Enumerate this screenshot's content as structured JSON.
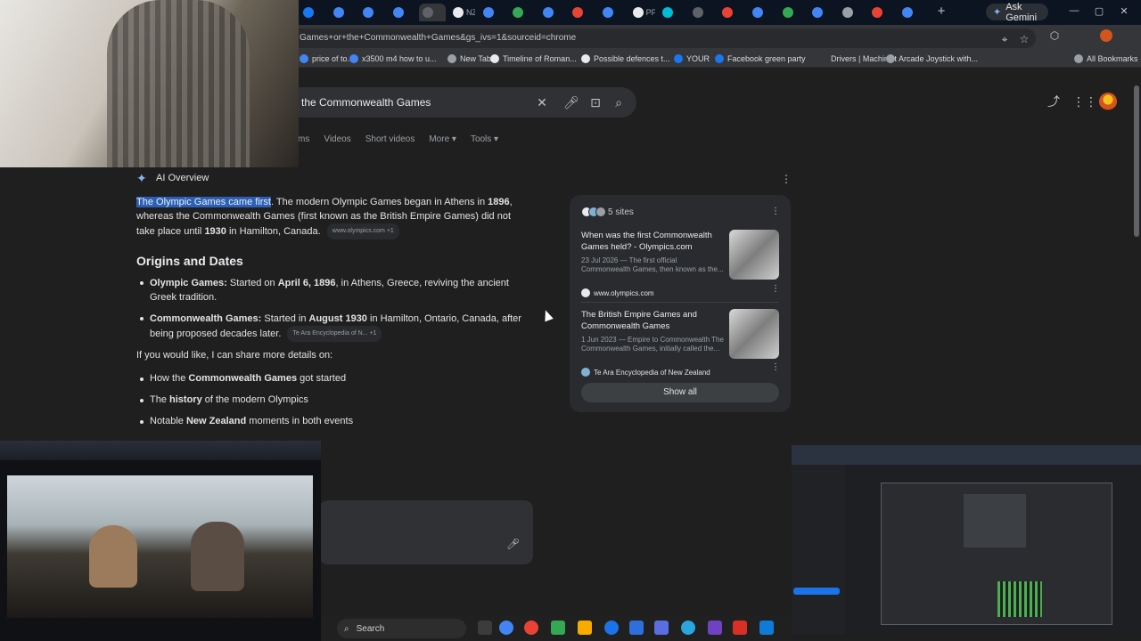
{
  "browser": {
    "ask_gemini": "Ask Gemini",
    "url": "Games+or+the+Commonwealth+Games&gs_ivs=1&sourceid=chrome",
    "tabs": [
      {
        "label": "",
        "color": "#1877f2"
      },
      {
        "label": "",
        "color": "#4285f4"
      },
      {
        "label": "",
        "color": "#4285f4"
      },
      {
        "label": "",
        "color": "#4285f4"
      },
      {
        "label": "",
        "color": "#5f6368"
      },
      {
        "label": "NZ",
        "color": "#e8eaed"
      },
      {
        "label": "",
        "color": "#4285f4"
      },
      {
        "label": "",
        "color": "#34a853"
      },
      {
        "label": "",
        "color": "#4285f4"
      },
      {
        "label": "",
        "color": "#ea4335"
      },
      {
        "label": "",
        "color": "#4285f4"
      },
      {
        "label": "PPF",
        "color": "#e8eaed"
      },
      {
        "label": "",
        "color": "#00bcd4"
      },
      {
        "label": "",
        "color": "#5f6368"
      },
      {
        "label": "",
        "color": "#ea4335"
      },
      {
        "label": "",
        "color": "#4285f4"
      },
      {
        "label": "",
        "color": "#34a853"
      },
      {
        "label": "",
        "color": "#4285f4"
      },
      {
        "label": "",
        "color": "#9aa0a6"
      },
      {
        "label": "",
        "color": "#ea4335"
      },
      {
        "label": "",
        "color": "#4285f4"
      }
    ]
  },
  "bookmarks": [
    {
      "label": "price of to...",
      "color": "#4285f4"
    },
    {
      "label": "x3500 m4 how to u...",
      "color": "#4285f4"
    },
    {
      "label": "New Tab",
      "color": "#9aa0a6"
    },
    {
      "label": "Timeline of Roman...",
      "color": "#e8eaed"
    },
    {
      "label": "Possible defences t...",
      "color": "#e8eaed"
    },
    {
      "label": "YOUR",
      "color": "#1877f2"
    },
    {
      "label": "Facebook green party",
      "color": "#1877f2"
    },
    {
      "label": "Drivers | Machinist",
      "color": "#35363a"
    },
    {
      "label": "Arcade Joystick with...",
      "color": "#9aa0a6"
    },
    {
      "label": "All Bookmarks",
      "color": "#9aa0a6"
    }
  ],
  "search": {
    "query": "the Commonwealth Games",
    "tabs": [
      "ms",
      "Videos",
      "Short videos",
      "More ▾",
      "Tools ▾"
    ]
  },
  "ai_overview": {
    "heading": "AI Overview",
    "p1_highlight": "The Olympic Games came first",
    "p1_a": ". The modern Olympic Games began in Athens in ",
    "p1_b": "1896",
    "p1_c": ", whereas the Commonwealth Games (first known as the British Empire Games) did not take place until ",
    "p1_d": "1930",
    "p1_e": " in Hamilton, Canada.",
    "p1_cite": "www.olympics.com +1",
    "h2": "Origins and Dates",
    "b1_label": "Olympic Games:",
    "b1_a": " Started on ",
    "b1_b": "April 6, 1896",
    "b1_c": ", in Athens, Greece, reviving the ancient Greek tradition.",
    "b2_label": "Commonwealth Games:",
    "b2_a": " Started in ",
    "b2_b": "August 1930",
    "b2_c": " in Hamilton, Ontario, Canada, after being proposed decades later.",
    "b2_cite": "Te Ara Encyclopedia of N... +1",
    "intro": "If you would like, I can share more details on:",
    "m1_a": "How the ",
    "m1_b": "Commonwealth Games",
    "m1_c": " got started",
    "m2_a": "The ",
    "m2_b": "history",
    "m2_c": " of the modern Olympics",
    "m3_a": "Notable ",
    "m3_b": "New Zealand",
    "m3_c": " moments in both events"
  },
  "sources": {
    "count_label": "5 sites",
    "items": [
      {
        "title": "When was the first Commonwealth Games held? - Olympics.com",
        "snippet": "23 Jul 2026 — The first official Commonwealth Games, then known as the...",
        "site": "www.olympics.com"
      },
      {
        "title": "The British Empire Games and Commonwealth Games",
        "snippet": "1 Jun 2023 — Empire to Commonwealth The Commonwealth Games, initially called the...",
        "site": "Te Ara Encyclopedia of New Zealand"
      }
    ],
    "show_all": "Show all"
  },
  "taskbar": {
    "search_label": "Search"
  },
  "colors": {
    "highlight": "#2d5fb3",
    "accent": "#8ab4f8"
  }
}
